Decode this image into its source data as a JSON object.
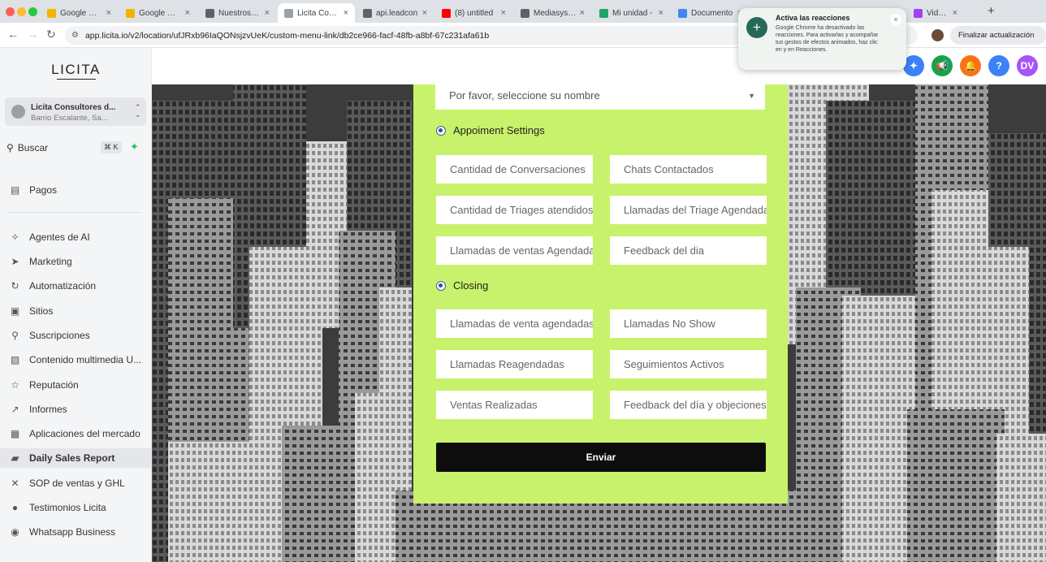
{
  "browser": {
    "tabs": [
      {
        "label": "Google Meet",
        "active": false,
        "color": "#f4b400"
      },
      {
        "label": "Google Meet",
        "active": false,
        "color": "#f4b400"
      },
      {
        "label": "Nuestros Co",
        "active": false,
        "color": "#5f6368"
      },
      {
        "label": "Licita Consu",
        "active": true,
        "color": "#9aa0a6"
      },
      {
        "label": "api.leadcon",
        "active": false,
        "color": "#5f6368"
      },
      {
        "label": "(8) untitled",
        "active": false,
        "color": "#ff0000"
      },
      {
        "label": "Mediasys.ia",
        "active": false,
        "color": "#5f6368"
      },
      {
        "label": "Mi unidad - ",
        "active": false,
        "color": "#1fa463"
      },
      {
        "label": "Documento",
        "active": false,
        "color": "#4285f4"
      },
      {
        "label": "Videos |",
        "active": false,
        "color": "#a142f4"
      }
    ],
    "tab_close": "×",
    "new_tab": "+",
    "back": "←",
    "forward": "→",
    "reload": "↻",
    "url": "app.licita.io/v2/location/ufJRxb96IaQONsjzvUeK/custom-menu-link/db2ce966-facf-48fb-a8bf-67c231afa61b",
    "update_button": "Finalizar actualización",
    "menu": "⋮"
  },
  "notification": {
    "title": "Activa las reacciones",
    "body": "Google Chrome ha desactivado las reacciones. Para activarlas y acompañar tus gestos de efectos animados, haz clic en y en Reacciones.",
    "icon": "+",
    "close": "×"
  },
  "header_icons": [
    {
      "name": "sparkle-icon",
      "glyph": "✦",
      "color": "#3b82f6"
    },
    {
      "name": "megaphone-icon",
      "glyph": "📢",
      "color": "#16a34a"
    },
    {
      "name": "bell-icon",
      "glyph": "🔔",
      "color": "#f97316"
    },
    {
      "name": "help-icon",
      "glyph": "?",
      "color": "#3b82f6"
    },
    {
      "name": "user-avatar",
      "glyph": "DV",
      "color": "#a855f7"
    }
  ],
  "sidebar": {
    "logo": "LICITA",
    "location": {
      "name": "Licita Consultores d...",
      "address": "Barrio Escalante, Sa..."
    },
    "search_label": "Buscar",
    "search_shortcut": "⌘ K",
    "items": [
      {
        "label": "Pagos",
        "icon": "▤",
        "active": false
      },
      {
        "label": "Agentes de AI",
        "icon": "✧",
        "active": false
      },
      {
        "label": "Marketing",
        "icon": "➤",
        "active": false
      },
      {
        "label": "Automatización",
        "icon": "↻",
        "active": false
      },
      {
        "label": "Sitios",
        "icon": "▣",
        "active": false
      },
      {
        "label": "Suscripciones",
        "icon": "⚲",
        "active": false
      },
      {
        "label": "Contenido multimedia U...",
        "icon": "▨",
        "active": false
      },
      {
        "label": "Reputación",
        "icon": "☆",
        "active": false
      },
      {
        "label": "Informes",
        "icon": "↗",
        "active": false
      },
      {
        "label": "Aplicaciones del mercado",
        "icon": "▦",
        "active": false
      },
      {
        "label": "Daily Sales Report",
        "icon": "▰",
        "active": true
      },
      {
        "label": "SOP de ventas y GHL",
        "icon": "✕",
        "active": false
      },
      {
        "label": "Testimonios Licita",
        "icon": "●",
        "active": false
      },
      {
        "label": "Whatsapp Business",
        "icon": "◉",
        "active": false
      }
    ]
  },
  "form": {
    "name_select_placeholder": "Por favor, seleccione su nombre",
    "sections": [
      {
        "title": "Appoiment Settings",
        "fields": [
          "Cantidad de Conversaciones",
          "Chats Contactados",
          "Cantidad de Triages atendidos",
          "Llamadas del Triage Agendadas",
          "Llamadas de ventas Agendadas",
          "Feedback del dia"
        ]
      },
      {
        "title": "Closing",
        "fields": [
          "Llamadas de venta agendadas",
          "Llamadas No Show",
          "Llamadas Reagendadas",
          "Seguimientos Activos",
          "Ventas Realizadas",
          "Feedback del día y objeciones"
        ]
      }
    ],
    "submit_label": "Enviar"
  }
}
